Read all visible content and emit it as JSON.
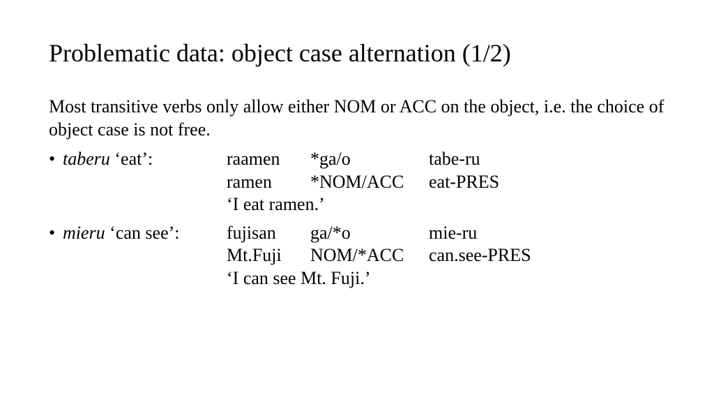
{
  "title": "Problematic data: object case alternation (1/2)",
  "intro": "Most transitive verbs only allow either NOM or ACC on the object, i.e. the choice of object case is not free.",
  "entries": [
    {
      "bullet": "•",
      "verb": "taberu",
      "verb_gloss": " ‘eat’:",
      "rows": [
        {
          "c1": "raamen",
          "c2": "*ga/o",
          "c3": "tabe-ru"
        },
        {
          "c1": "ramen",
          "c2": "*NOM/ACC",
          "c3": "eat-PRES"
        }
      ],
      "translation": "‘I eat ramen.’"
    },
    {
      "bullet": "•",
      "verb": "mieru",
      "verb_gloss": " ‘can see’:",
      "rows": [
        {
          "c1": "fujisan",
          "c2": "ga/*o",
          "c3": "mie-ru"
        },
        {
          "c1": "Mt.Fuji",
          "c2": "NOM/*ACC",
          "c3": "can.see-PRES"
        }
      ],
      "translation": "‘I can see Mt. Fuji.’"
    }
  ]
}
